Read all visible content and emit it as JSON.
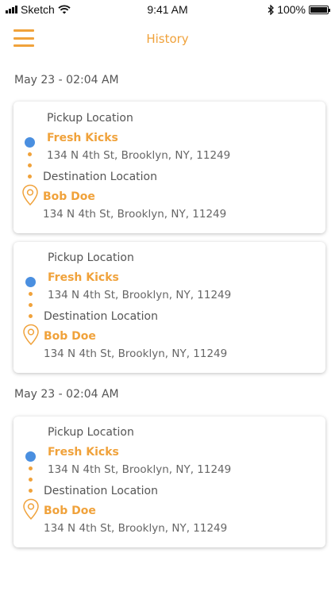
{
  "status_bar": {
    "carrier": "Sketch",
    "time": "9:41 AM",
    "battery": "100%",
    "battery_level": 1.0
  },
  "header": {
    "title": "History",
    "menu_icon": "hamburger-menu-icon"
  },
  "groups": [
    {
      "date": "May 23 - 02:04 AM"
    },
    {
      "date": "May 23 - 02:04 AM"
    }
  ],
  "trips": [
    {
      "pickup_label": "Pickup Location",
      "pickup_name": "Fresh Kicks",
      "pickup_address": "134 N 4th St, Brooklyn, NY, 11249",
      "destination_label": "Destination Location",
      "destination_name": "Bob Doe",
      "destination_address": "134 N 4th St,  Brooklyn, NY, 11249"
    },
    {
      "pickup_label": "Pickup Location",
      "pickup_name": "Fresh Kicks",
      "pickup_address": "134 N 4th St, Brooklyn, NY, 11249",
      "destination_label": "Destination Location",
      "destination_name": "Bob Doe",
      "destination_address": "134 N 4th St,  Brooklyn, NY, 11249"
    },
    {
      "pickup_label": "Pickup Location",
      "pickup_name": "Fresh Kicks",
      "pickup_address": "134 N 4th St, Brooklyn, NY, 11249",
      "destination_label": "Destination Location",
      "destination_name": "Bob Doe",
      "destination_address": "134 N 4th St,  Brooklyn, NY, 11249"
    }
  ],
  "colors": {
    "accent": "#f0a23b",
    "pickup_dot": "#4a8fe0",
    "text": "#555555"
  }
}
